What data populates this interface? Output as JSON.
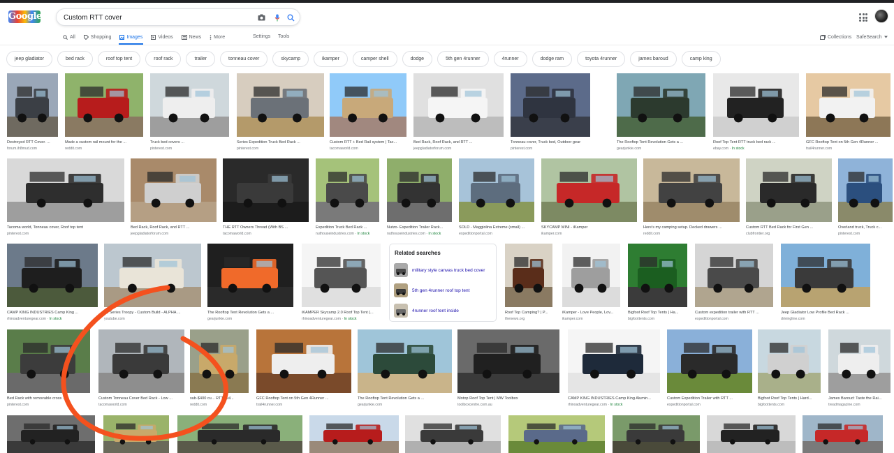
{
  "header": {
    "logo_text": "Google",
    "search_value": "Custom RTT cover",
    "icons": [
      "camera-icon",
      "mic-icon",
      "search-icon",
      "apps-icon"
    ]
  },
  "tabs": [
    {
      "label": "All",
      "icon": "search-icon"
    },
    {
      "label": "Shopping",
      "icon": "tag-icon"
    },
    {
      "label": "Images",
      "icon": "image-icon",
      "active": true
    },
    {
      "label": "Videos",
      "icon": "play-icon"
    },
    {
      "label": "News",
      "icon": "news-icon"
    },
    {
      "label": "More",
      "icon": "more-icon"
    }
  ],
  "tools": {
    "settings": "Settings",
    "tools": "Tools"
  },
  "header_right": {
    "collections": "Collections",
    "safesearch": "SafeSearch"
  },
  "chips": [
    "jeep gladiator",
    "bed rack",
    "roof top tent",
    "roof rack",
    "trailer",
    "tonneau cover",
    "skycamp",
    "ikamper",
    "camper shell",
    "dodge",
    "5th gen 4runner",
    "4runner",
    "dodge ram",
    "toyota 4runner",
    "james baroud",
    "camp king"
  ],
  "colors": {
    "accent": "#1a73e8",
    "link": "#1a0dab",
    "in_stock": "#188038",
    "annotation": "#f4511e"
  },
  "rows": [
    [
      {
        "caption": "Destroyed RTT Cover. ...",
        "source": "forum.ih8mud.com",
        "stock": "",
        "sky": "#9aa7b8",
        "ground": "#6f6a60",
        "body": "#3b3f45"
      },
      {
        "caption": "Made a custom rail mount for the ...",
        "source": "reddit.com",
        "stock": "",
        "sky": "#8fb36b",
        "ground": "#8a7a62",
        "body": "#b71c1c"
      },
      {
        "caption": "Truck bed covers ...",
        "source": "pinterest.com",
        "stock": "",
        "sky": "#cfd8dc",
        "ground": "#9e9e9e",
        "body": "#eeeeee"
      },
      {
        "caption": "Series Expedition Truck Bed Rack ...",
        "source": "pinterest.com",
        "stock": "",
        "sky": "#d7cdbf",
        "ground": "#b49a6a",
        "body": "#6b7178"
      },
      {
        "caption": "Custom RTT + Bed Rail system | Tac...",
        "source": "tacomaworld.com",
        "stock": "",
        "sky": "#90caf9",
        "ground": "#a1887f",
        "body": "#c8a97a"
      },
      {
        "caption": "Bed Rack, Roof Rack, and RTT ...",
        "source": "jeepgladiatorforum.com",
        "stock": "",
        "sky": "#e0e0e0",
        "ground": "#bdbdbd",
        "body": "#f5f5f5"
      },
      {
        "caption": "Tonneau cover, Truck bed, Outdoor gear",
        "source": "pinterest.com",
        "stock": "",
        "sky": "#5c6b8a",
        "ground": "#3a3f4b",
        "body": "#2f3440"
      },
      {
        "caption": "The Rooftop Tent Revolution Gets a ...",
        "source": "gearjunkie.com",
        "stock": "",
        "sky": "#7fa7b4",
        "ground": "#4e6b4a",
        "body": "#2c3a2e"
      },
      {
        "caption": "Roof Top Tent RTT truck bed rack ...",
        "source": "ebay.com",
        "stock": "In stock",
        "sky": "#e8e8e8",
        "ground": "#d0d0d0",
        "body": "#222222"
      },
      {
        "caption": "GFC Rooftop Tent on 5th Gen 4Runner ...",
        "source": "trail4runner.com",
        "stock": "",
        "sky": "#e6c9a3",
        "ground": "#8d7757",
        "body": "#f2f2f2"
      }
    ],
    [
      {
        "caption": "Tacoma world, Tonneau cover, Roof top tent",
        "source": "pinterest.com",
        "stock": "",
        "sky": "#d9d9d9",
        "ground": "#9e9e9e",
        "body": "#2e2e2e"
      },
      {
        "caption": "Bed Rack, Roof Rack, and RTT ...",
        "source": "jeepgladiatorforum.com",
        "stock": "",
        "sky": "#a98a6a",
        "ground": "#b59f84",
        "body": "#cfcfcf"
      },
      {
        "caption": "THE RTT Owners Thread (With BS ...",
        "source": "tacomaworld.com",
        "stock": "",
        "sky": "#2a2a2a",
        "ground": "#1c1c1c",
        "body": "#3a3a3a"
      },
      {
        "caption": "Expedition Truck Bed Rack ...",
        "source": "nuthouseindustries.com",
        "stock": "In stock",
        "sky": "#a5c27a",
        "ground": "#7a7a7a",
        "body": "#4a4a4a"
      },
      {
        "caption": "Nutzo- Expedition Trailer Rack...",
        "source": "nuthouseindustries.com",
        "stock": "In stock",
        "sky": "#8fae6b",
        "ground": "#6e6e6e",
        "body": "#333333"
      },
      {
        "caption": "SOLD - Maggiolina Extreme (small) ...",
        "source": "expeditionportal.com",
        "stock": "",
        "sky": "#a7c3d9",
        "ground": "#8a9a5b",
        "body": "#5d6d7e"
      },
      {
        "caption": "SKYCAMP MINI - iKamper",
        "source": "ikamper.com",
        "stock": "",
        "sky": "#b0c4a2",
        "ground": "#7d8a63",
        "body": "#c62828"
      },
      {
        "caption": "Here's my camping setup. Decked drawers ...",
        "source": "reddit.com",
        "stock": "",
        "sky": "#c8b89a",
        "ground": "#9f8c6c",
        "body": "#424242"
      },
      {
        "caption": "Custom RTT Bed Rack for First Gen ...",
        "source": "clubfrontier.org",
        "stock": "",
        "sky": "#cfd3c4",
        "ground": "#9aa08a",
        "body": "#2a2a2a"
      },
      {
        "caption": "Overland truck, Truck c...",
        "source": "pinterest.com",
        "stock": "",
        "sky": "#8fb3d9",
        "ground": "#8a8a6a",
        "body": "#2b4f7e"
      }
    ],
    [
      {
        "caption": "CAMP KING INDUSTRIES Camp King ...",
        "source": "rhinoadventuregear.com",
        "stock": "In stock",
        "sky": "#6c7a8a",
        "ground": "#4c5a3c",
        "body": "#1e1e1e"
      },
      {
        "caption": "78 Series Troopy - Custom Build - ALPHA ...",
        "source": "youtube.com",
        "stock": "",
        "sky": "#bcc7cf",
        "ground": "#a99a84",
        "body": "#e9e4d8"
      },
      {
        "caption": "The Rooftop Tent Revolution Gets a ...",
        "source": "gearjunkie.com",
        "stock": "",
        "sky": "#1f1f1f",
        "ground": "#2a2a2a",
        "body": "#f06a2a"
      },
      {
        "caption": "iKAMPER Skycamp 2.0 Roof Top Tent (...",
        "source": "rhinoadventuregear.com",
        "stock": "In stock",
        "sky": "#f5f5f5",
        "ground": "#e0e0e0",
        "body": "#555555"
      },
      {
        "caption": "Roof Top Camping? | P...",
        "source": "thenews.org",
        "stock": "",
        "sky": "#d9d2c5",
        "ground": "#8a7a62",
        "body": "#5a2d1a"
      },
      {
        "caption": "iKamper - Love People, Lov...",
        "source": "ikamper.com",
        "stock": "",
        "sky": "#f2f2f2",
        "ground": "#dcdcdc",
        "body": "#9e9e9e"
      },
      {
        "caption": "Bigfoot Roof Top Tents | Ha...",
        "source": "bigfoottents.com",
        "stock": "",
        "sky": "#2e7d32",
        "ground": "#3b3b3b",
        "body": "#1b5e20"
      },
      {
        "caption": "Custom expedition trailer with RTT ...",
        "source": "expeditionportal.com",
        "stock": "",
        "sky": "#d5d5d5",
        "ground": "#b0a58f",
        "body": "#4a4a4a"
      },
      {
        "caption": "Jeep Gladiator Low Profile Bed Rack ...",
        "source": "drivingline.com",
        "stock": "",
        "sky": "#7fb0d9",
        "ground": "#b8a371",
        "body": "#3a3a3a"
      }
    ],
    [
      {
        "caption": "Bed Rack with removable cross ...",
        "source": "pinterest.com",
        "stock": "",
        "sky": "#5a7d4a",
        "ground": "#6a6a6a",
        "body": "#3c3c3c"
      },
      {
        "caption": "Custom Tonneau Cover Bed Rack - Low ...",
        "source": "tacomaworld.com",
        "stock": "",
        "sky": "#b0b6bb",
        "ground": "#8e8e8e",
        "body": "#3a3a3a"
      },
      {
        "caption": "sub-$400 cu... RTT buil...",
        "source": "reddit.com",
        "stock": "",
        "sky": "#9aa08a",
        "ground": "#8a7a52",
        "body": "#c8a96a"
      },
      {
        "caption": "GFC Rooftop Tent on 5th Gen 4Runner ...",
        "source": "trail4runner.com",
        "stock": "",
        "sky": "#b8743a",
        "ground": "#7a4a2a",
        "body": "#eeeeee"
      },
      {
        "caption": "The Rooftop Tent Revolution Gets a ...",
        "source": "gearjunkie.com",
        "stock": "",
        "sky": "#9fc5d9",
        "ground": "#c9b48a",
        "body": "#2c4a3a"
      },
      {
        "caption": "Motop Roof Top Tent | MW Toolbox",
        "source": "toolboxcentre.com.au",
        "stock": "",
        "sky": "#6a6a6a",
        "ground": "#3a3a3a",
        "body": "#202020"
      },
      {
        "caption": "CAMP KING INDUSTRIES Camp King Alumin...",
        "source": "rhinoadventuregear.com",
        "stock": "In stock",
        "sky": "#f5f5f5",
        "ground": "#e5e5e5",
        "body": "#1e2a3a"
      },
      {
        "caption": "Custom Expedition Trailer with RTT ...",
        "source": "expeditionportal.com",
        "stock": "",
        "sky": "#8ab0d9",
        "ground": "#6a8a3a",
        "body": "#2a2a2a"
      },
      {
        "caption": "Bigfoot Roof Top Tents | Hard...",
        "source": "bigfoottents.com",
        "stock": "",
        "sky": "#c8d8e0",
        "ground": "#a9b08a",
        "body": "#d0d0d0"
      },
      {
        "caption": "James Baroud: Taste the Rai...",
        "source": "treadmagazine.com",
        "stock": "",
        "sky": "#cfd8dc",
        "ground": "#9e9e9e",
        "body": "#eeeeee"
      }
    ],
    [
      {
        "caption": "",
        "source": "",
        "stock": "",
        "sky": "#6e6e6e",
        "ground": "#3a3a3a",
        "body": "#222222"
      },
      {
        "caption": "",
        "source": "",
        "stock": "",
        "sky": "#9ab36a",
        "ground": "#6a6a5a",
        "body": "#c8a96a"
      },
      {
        "caption": "",
        "source": "",
        "stock": "",
        "sky": "#8ab07a",
        "ground": "#5a5a4a",
        "body": "#2a2a2a"
      },
      {
        "caption": "",
        "source": "",
        "stock": "",
        "sky": "#c9d9e9",
        "ground": "#9a8a7a",
        "body": "#b71c1c"
      },
      {
        "caption": "",
        "source": "",
        "stock": "",
        "sky": "#e0e0e0",
        "ground": "#b0b0b0",
        "body": "#3a3a3a"
      },
      {
        "caption": "",
        "source": "",
        "stock": "",
        "sky": "#b5c97a",
        "ground": "#6a8a3a",
        "body": "#5a6a8a"
      },
      {
        "caption": "",
        "source": "",
        "stock": "",
        "sky": "#7a9a6a",
        "ground": "#4a4a3a",
        "body": "#3a3a3a"
      },
      {
        "caption": "",
        "source": "",
        "stock": "",
        "sky": "#d8d8d8",
        "ground": "#bdbdbd",
        "body": "#222222"
      },
      {
        "caption": "",
        "source": "",
        "stock": "",
        "sky": "#9fb6c9",
        "ground": "#7a7a7a",
        "body": "#c62828"
      }
    ]
  ],
  "related": {
    "title": "Related searches",
    "items": [
      {
        "label": "military style canvas truck bed cover",
        "sky": "#a9a9a9",
        "body": "#4a4a4a"
      },
      {
        "label": "5th gen 4runner roof top tent",
        "sky": "#b0a080",
        "body": "#3a3a3a"
      },
      {
        "label": "4runner roof tent inside",
        "sky": "#c8c0b0",
        "body": "#6a6a6a"
      }
    ]
  }
}
